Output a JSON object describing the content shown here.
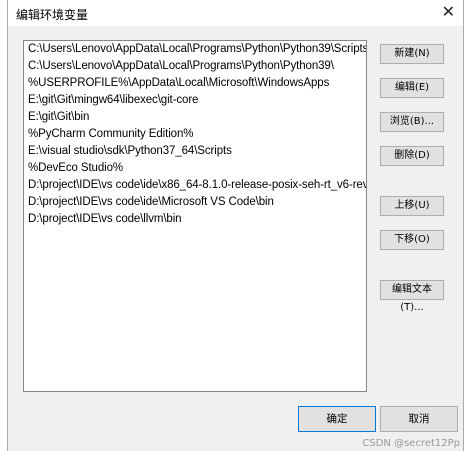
{
  "dialog": {
    "title": "编辑环境变量"
  },
  "paths": [
    "C:\\Users\\Lenovo\\AppData\\Local\\Programs\\Python\\Python39\\Scripts\\",
    "C:\\Users\\Lenovo\\AppData\\Local\\Programs\\Python\\Python39\\",
    "%USERPROFILE%\\AppData\\Local\\Microsoft\\WindowsApps",
    "E:\\git\\Git\\mingw64\\libexec\\git-core",
    "E:\\git\\Git\\bin",
    "%PyCharm Community Edition%",
    "E:\\visual studio\\sdk\\Python37_64\\Scripts",
    "%DevEco Studio%",
    "D:\\project\\IDE\\vs code\\ide\\x86_64-8.1.0-release-posix-seh-rt_v6-rev...",
    "D:\\project\\IDE\\vs code\\ide\\Microsoft VS Code\\bin",
    "D:\\project\\IDE\\vs code\\llvm\\bin"
  ],
  "buttons": {
    "new": "新建(N)",
    "edit": "编辑(E)",
    "browse": "浏览(B)...",
    "delete": "删除(D)",
    "move_up": "上移(U)",
    "move_down": "下移(O)",
    "edit_text": "编辑文本(T)...",
    "ok": "确定",
    "cancel": "取消"
  },
  "watermark": "CSDN @secret12Pp"
}
